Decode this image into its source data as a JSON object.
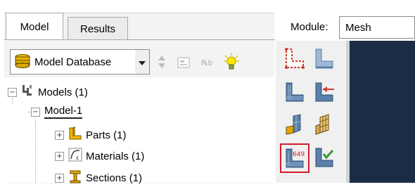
{
  "tabs": [
    {
      "label": "Model",
      "active": true
    },
    {
      "label": "Results",
      "active": false
    }
  ],
  "model_db": {
    "label": "Model Database"
  },
  "tree": {
    "models": "Models (1)",
    "model1": "Model-1",
    "parts": "Parts (1)",
    "materials": "Materials (1)",
    "sections": "Sections (1)"
  },
  "module": {
    "label": "Module:",
    "value": "Mesh"
  },
  "tools": {
    "seed_count_label": "649"
  },
  "colors": {
    "viewport": "#1b2d44",
    "selected_outline": "#d21b2b",
    "part_blue": "#5a7fa8",
    "part_pink": "#e06a8a"
  }
}
